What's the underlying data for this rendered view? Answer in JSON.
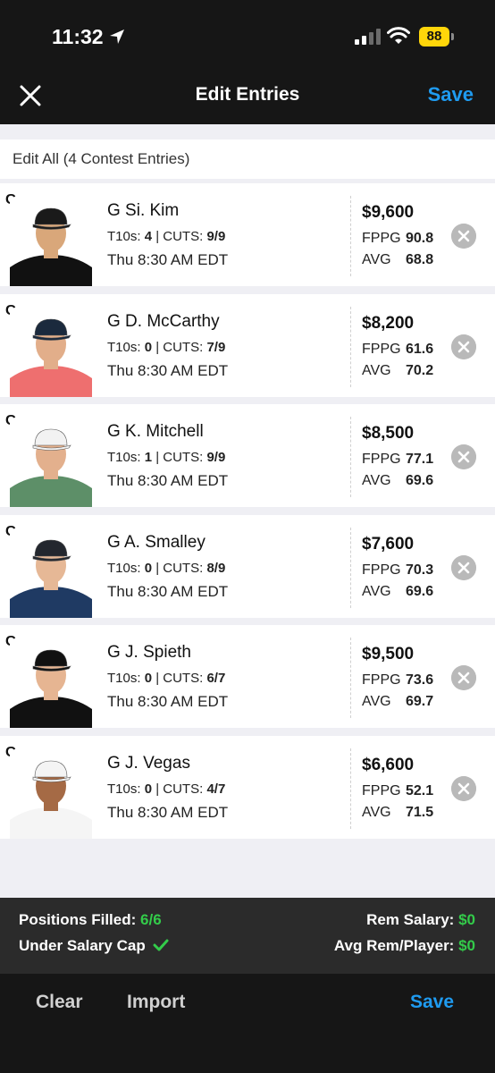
{
  "status_bar": {
    "time": "11:32",
    "battery": "88"
  },
  "header": {
    "title": "Edit Entries",
    "save_label": "Save",
    "close_icon": "close-icon"
  },
  "edit_all_label": "Edit All (4 Contest Entries)",
  "stat_labels": {
    "t10s": "T10s:",
    "cuts": "CUTS:",
    "fppg": "FPPG",
    "avg": "AVG"
  },
  "players": [
    {
      "pos": "G",
      "name": "G  Si. Kim",
      "t10s": "4",
      "cuts": "9/9",
      "time": "Thu 8:30 AM EDT",
      "salary": "$9,600",
      "fppg": "90.8",
      "avg": "68.8",
      "skin": "#d9a77a",
      "hat": "#1a1a1a",
      "shirt": "#111111"
    },
    {
      "pos": "G",
      "name": "G  D. McCarthy",
      "t10s": "0",
      "cuts": "7/9",
      "time": "Thu 8:30 AM EDT",
      "salary": "$8,200",
      "fppg": "61.6",
      "avg": "70.2",
      "skin": "#e2ae8a",
      "hat": "#1b2a3d",
      "shirt": "#ee6f6f"
    },
    {
      "pos": "G",
      "name": "G  K. Mitchell",
      "t10s": "1",
      "cuts": "9/9",
      "time": "Thu 8:30 AM EDT",
      "salary": "$8,500",
      "fppg": "77.1",
      "avg": "69.6",
      "skin": "#e3b08d",
      "hat": "#f2f2f2",
      "shirt": "#5d8f68"
    },
    {
      "pos": "G",
      "name": "G  A. Smalley",
      "t10s": "0",
      "cuts": "8/9",
      "time": "Thu 8:30 AM EDT",
      "salary": "$7,600",
      "fppg": "70.3",
      "avg": "69.6",
      "skin": "#e6b896",
      "hat": "#23272e",
      "shirt": "#1f3a63"
    },
    {
      "pos": "G",
      "name": "G  J. Spieth",
      "t10s": "0",
      "cuts": "6/7",
      "time": "Thu 8:30 AM EDT",
      "salary": "$9,500",
      "fppg": "73.6",
      "avg": "69.7",
      "skin": "#e6b592",
      "hat": "#111111",
      "shirt": "#111111"
    },
    {
      "pos": "G",
      "name": "G  J. Vegas",
      "t10s": "0",
      "cuts": "4/7",
      "time": "Thu 8:30 AM EDT",
      "salary": "$6,600",
      "fppg": "52.1",
      "avg": "71.5",
      "skin": "#a56a45",
      "hat": "#f4f4f4",
      "shirt": "#f5f5f5"
    }
  ],
  "summary": {
    "positions_label": "Positions Filled:",
    "positions_value": "6/6",
    "salary_cap_label": "Under Salary Cap",
    "rem_salary_label": "Rem Salary:",
    "rem_salary_value": "$0",
    "avg_rem_label": "Avg Rem/Player:",
    "avg_rem_value": "$0"
  },
  "footer": {
    "clear_label": "Clear",
    "import_label": "Import",
    "save_label": "Save"
  },
  "colors": {
    "accent": "#1f9bf0",
    "success": "#33cc4a"
  }
}
